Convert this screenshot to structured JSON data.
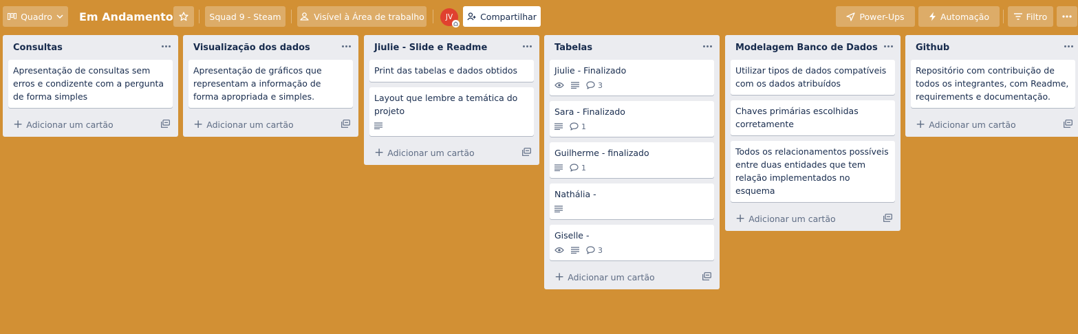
{
  "header": {
    "view_label": "Quadro",
    "board_title": "Em Andamento",
    "workspace_label": "Squad 9 - Steam",
    "visibility_label": "Visível à Área de trabalho",
    "avatar_initials": "JV",
    "share_label": "Compartilhar",
    "powerups_label": "Power-Ups",
    "automation_label": "Automação",
    "filter_label": "Filtro"
  },
  "colors": {
    "background": "#d29034",
    "list_bg": "#ebecf0",
    "avatar": "#e0412f"
  },
  "add_card_label": "Adicionar um cartão",
  "lists": [
    {
      "title": "Consultas",
      "cards": [
        {
          "text": "Apresentação de consultas sem erros e condizente com a pergunta de forma simples",
          "badges": []
        }
      ]
    },
    {
      "title": "Visualização dos dados",
      "cards": [
        {
          "text": "Apresentação de gráficos que representam a informação de forma apropriada e simples.",
          "badges": []
        }
      ]
    },
    {
      "title": "Jiulie - Slide e Readme",
      "cards": [
        {
          "text": "Print das tabelas e dados obtidos",
          "badges": []
        },
        {
          "text": "Layout que lembre a temática do projeto",
          "badges": [
            {
              "icon": "description-icon"
            }
          ]
        }
      ]
    },
    {
      "title": "Tabelas",
      "cards": [
        {
          "text": "Jiulie - Finalizado",
          "badges": [
            {
              "icon": "eye-icon"
            },
            {
              "icon": "description-icon"
            },
            {
              "icon": "comment-icon",
              "count": "3"
            }
          ]
        },
        {
          "text": "Sara - Finalizado",
          "badges": [
            {
              "icon": "description-icon"
            },
            {
              "icon": "comment-icon",
              "count": "1"
            }
          ]
        },
        {
          "text": "Guilherme - finalizado",
          "badges": [
            {
              "icon": "description-icon"
            },
            {
              "icon": "comment-icon",
              "count": "1"
            }
          ]
        },
        {
          "text": "Nathália -",
          "badges": [
            {
              "icon": "description-icon"
            }
          ]
        },
        {
          "text": "Giselle -",
          "badges": [
            {
              "icon": "eye-icon"
            },
            {
              "icon": "description-icon"
            },
            {
              "icon": "comment-icon",
              "count": "3"
            }
          ]
        }
      ]
    },
    {
      "title": "Modelagem Banco de Dados",
      "cards": [
        {
          "text": "Utilizar tipos de dados compatíveis com os dados atribuídos",
          "badges": []
        },
        {
          "text": "Chaves primárias escolhidas corretamente",
          "badges": []
        },
        {
          "text": "Todos os relacionamentos possíveis entre duas entidades que tem relação implementados no esquema",
          "badges": []
        }
      ]
    },
    {
      "title": "Github",
      "cards": [
        {
          "text": "Repositório com contribuição de todos os integrantes, com Readme, requirements e documentação.",
          "badges": []
        }
      ]
    }
  ]
}
